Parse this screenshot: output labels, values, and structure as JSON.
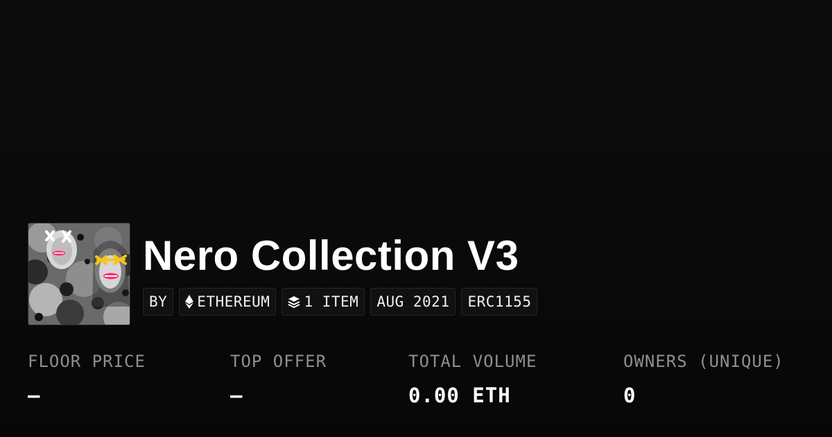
{
  "collection": {
    "name": "Nero Collection V3",
    "thumbnail_icon": "collection-avatar-image"
  },
  "chips": {
    "by_label": "BY",
    "chain_label": "ETHEREUM",
    "chain_icon": "ethereum-icon",
    "items_label": "1 ITEM",
    "items_icon": "layers-icon",
    "date_label": "AUG 2021",
    "standard_label": "ERC1155"
  },
  "stats": {
    "floor_price": {
      "label": "FLOOR PRICE",
      "value": "—"
    },
    "top_offer": {
      "label": "TOP OFFER",
      "value": "—"
    },
    "total_volume": {
      "label": "TOTAL VOLUME",
      "value": "0.00 ETH"
    },
    "owners": {
      "label": "OWNERS (UNIQUE)",
      "value": "0"
    }
  },
  "colors": {
    "background": "#0a0a0a",
    "text_primary": "#ffffff",
    "text_muted": "#8f8f8f",
    "chip_border": "#262626",
    "accent_yellow": "#f5c518",
    "accent_pink": "#ff2e7a"
  }
}
